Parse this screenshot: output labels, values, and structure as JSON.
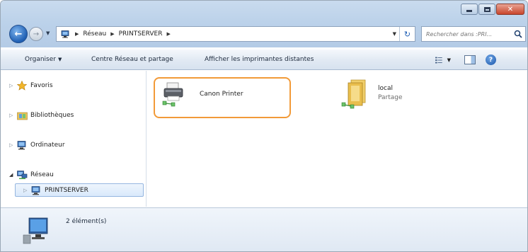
{
  "window": {
    "controls": {
      "minimize": "minimize",
      "maximize": "maximize",
      "close": "close"
    }
  },
  "address_bar": {
    "crumbs": [
      "Réseau",
      "PRINTSERVER"
    ]
  },
  "search": {
    "placeholder": "Rechercher dans :PRI..."
  },
  "toolbar": {
    "organize_label": "Organiser",
    "network_center_label": "Centre Réseau et partage",
    "remote_printers_label": "Afficher les imprimantes distantes"
  },
  "sidebar": {
    "items": [
      {
        "label": "Favoris",
        "icon": "star-icon"
      },
      {
        "label": "Bibliothèques",
        "icon": "library-icon"
      },
      {
        "label": "Ordinateur",
        "icon": "computer-icon"
      },
      {
        "label": "Réseau",
        "icon": "network-icon"
      },
      {
        "label": "PRINTSERVER",
        "icon": "computer-icon",
        "selected": true
      }
    ]
  },
  "content": {
    "items": [
      {
        "name": "Canon Printer",
        "type": "printer",
        "icon": "shared-printer-icon",
        "highlight_color": "#f29a38"
      },
      {
        "name": "local",
        "subtitle": "Partage",
        "type": "folder",
        "icon": "shared-folder-icon"
      }
    ]
  },
  "details": {
    "item_count": "2 élément(s)"
  },
  "colors": {
    "accent_highlight": "#f29a38",
    "selection": "#d9e9fb",
    "chrome": "#bcd2ea"
  }
}
